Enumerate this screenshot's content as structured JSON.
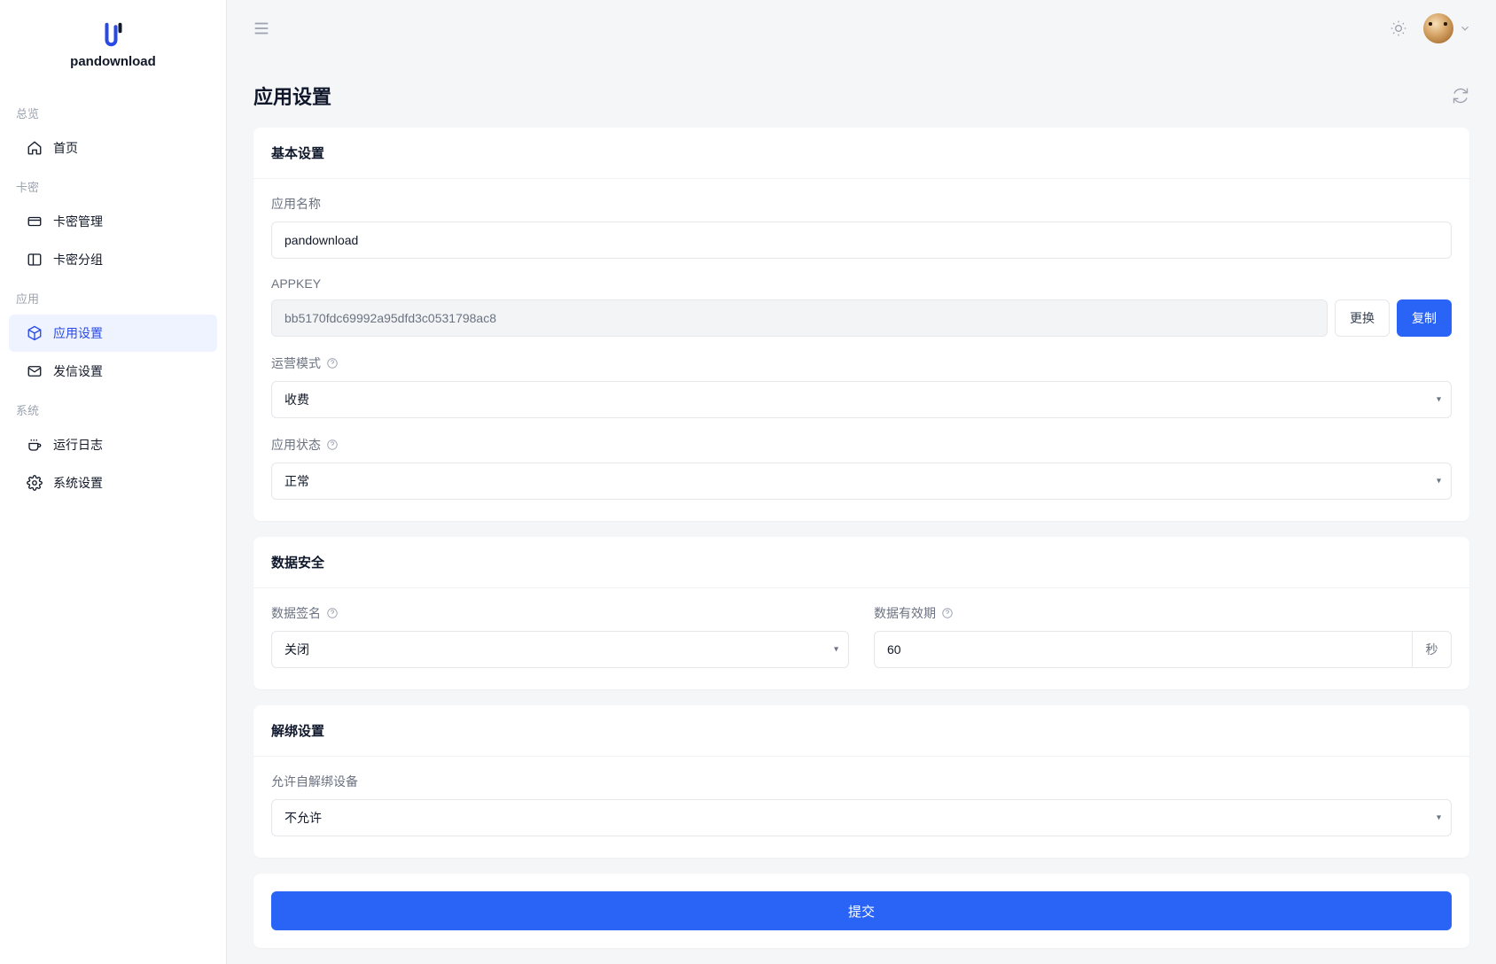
{
  "brand": {
    "name": "pandownload"
  },
  "sidebar": {
    "groups": [
      {
        "title": "总览",
        "items": [
          {
            "label": "首页"
          }
        ]
      },
      {
        "title": "卡密",
        "items": [
          {
            "label": "卡密管理"
          },
          {
            "label": "卡密分组"
          }
        ]
      },
      {
        "title": "应用",
        "items": [
          {
            "label": "应用设置"
          },
          {
            "label": "发信设置"
          }
        ]
      },
      {
        "title": "系统",
        "items": [
          {
            "label": "运行日志"
          },
          {
            "label": "系统设置"
          }
        ]
      }
    ]
  },
  "page": {
    "title": "应用设置"
  },
  "sections": {
    "basic": {
      "title": "基本设置",
      "app_name_label": "应用名称",
      "app_name_value": "pandownload",
      "appkey_label": "APPKEY",
      "appkey_value": "bb5170fdc69992a95dfd3c0531798ac8",
      "regen_label": "更换",
      "copy_label": "复制",
      "op_mode_label": "运营模式",
      "op_mode_value": "收费",
      "app_status_label": "应用状态",
      "app_status_value": "正常"
    },
    "security": {
      "title": "数据安全",
      "sign_label": "数据签名",
      "sign_value": "关闭",
      "ttl_label": "数据有效期",
      "ttl_value": "60",
      "ttl_suffix": "秒"
    },
    "unbind": {
      "title": "解绑设置",
      "allow_label": "允许自解绑设备",
      "allow_value": "不允许"
    }
  },
  "submit_label": "提交"
}
